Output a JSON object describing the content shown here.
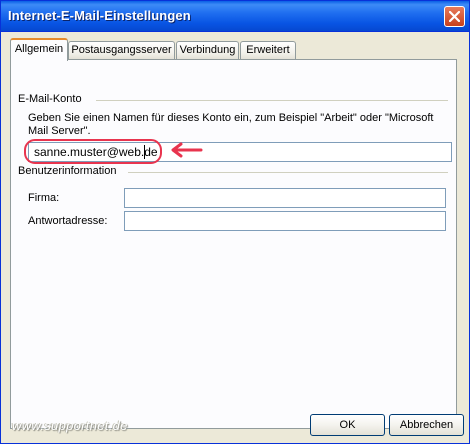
{
  "window": {
    "title": "Internet-E-Mail-Einstellungen"
  },
  "tabs": [
    {
      "label": "Allgemein",
      "active": true
    },
    {
      "label": "Postausgangsserver",
      "active": false
    },
    {
      "label": "Verbindung",
      "active": false
    },
    {
      "label": "Erweitert",
      "active": false
    }
  ],
  "account_section": {
    "title": "E-Mail-Konto",
    "help_text": "Geben Sie einen Namen für dieses Konto ein, zum Beispiel \"Arbeit\" oder \"Microsoft Mail Server\".",
    "value": "sanne.muster@web.de"
  },
  "user_section": {
    "title": "Benutzerinformation",
    "firma_label": "Firma:",
    "firma_value": "",
    "antwort_label": "Antwortadresse:",
    "antwort_value": ""
  },
  "buttons": {
    "ok": "OK",
    "cancel": "Abbrechen"
  },
  "watermark": "www.supportnet.de",
  "colors": {
    "titlebar": "#0a5fe6",
    "annotation": "#e8344e",
    "active_tab_accent": "#e68b2c"
  },
  "icons": [
    "close-icon",
    "arrow-left-icon"
  ]
}
